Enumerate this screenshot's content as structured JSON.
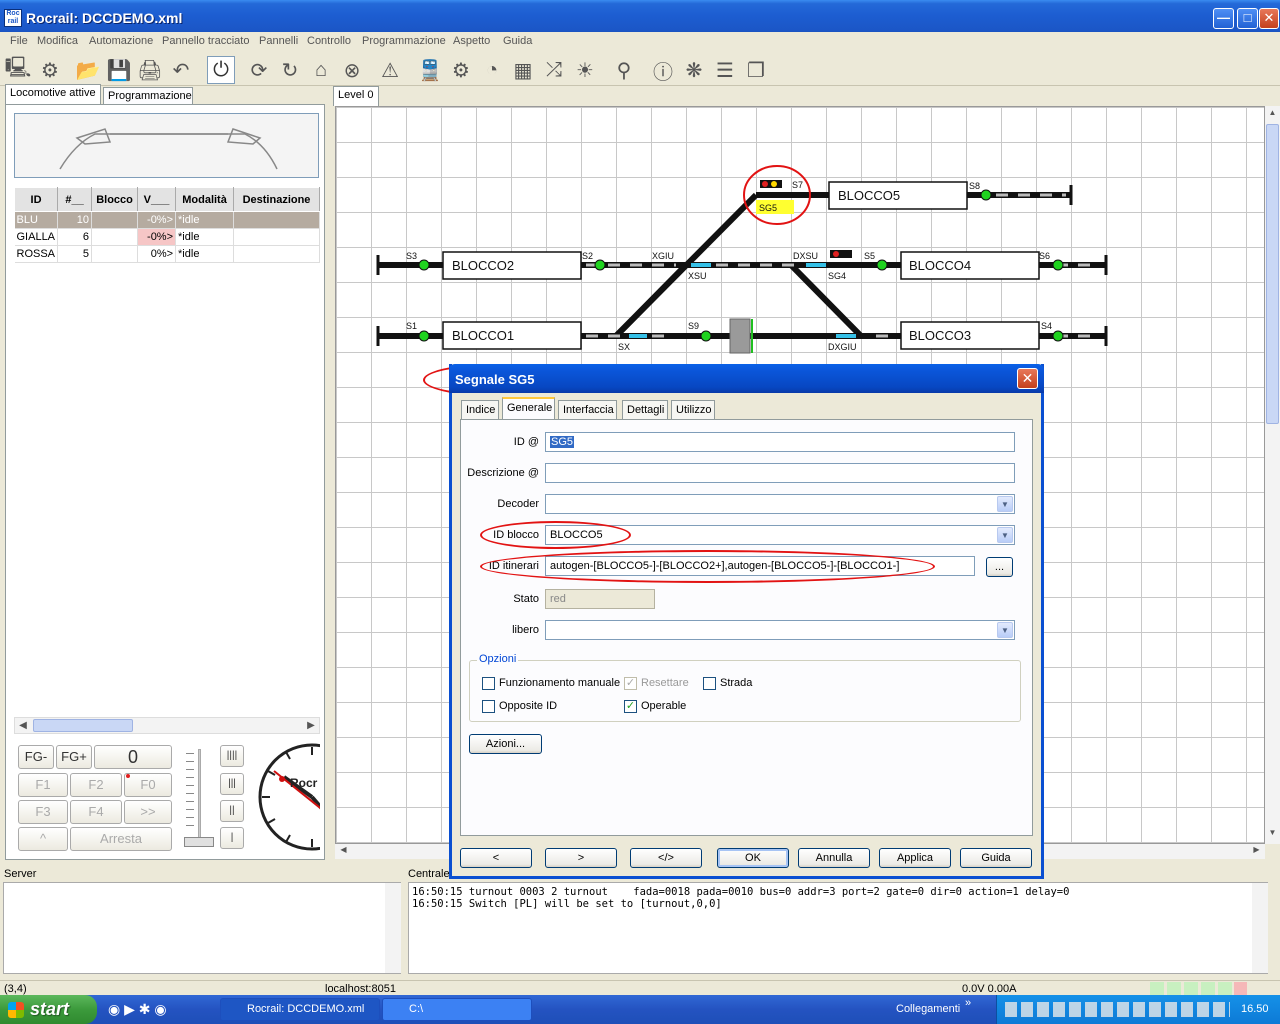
{
  "window": {
    "title": "Rocrail: DCCDEMO.xml",
    "icon_text": "Roc rail"
  },
  "menu": [
    "File",
    "Modifica",
    "Automazione",
    "Pannello tracciato",
    "Pannelli",
    "Controllo",
    "Programmazione",
    "Aspetto",
    "Guida"
  ],
  "left_tabs": [
    "Locomotive attive",
    "Programmazione"
  ],
  "loco_table": {
    "headers": [
      "ID",
      "#__",
      "Blocco",
      "V___",
      "Modalità",
      "Destinazione"
    ],
    "rows": [
      [
        "BLU",
        "10",
        "",
        "-0%>",
        "*idle",
        ""
      ],
      [
        "GIALLA",
        "6",
        "",
        "-0%>",
        "*idle",
        ""
      ],
      [
        "ROSSA",
        "5",
        "",
        "0%>",
        "*idle",
        ""
      ]
    ]
  },
  "controls": {
    "fg_minus": "FG-",
    "fg_plus": "FG+",
    "speed": "0",
    "f1": "F1",
    "f2": "F2",
    "f0": "F0",
    "f3": "F3",
    "f4": "F4",
    "more": ">>",
    "dir": "^",
    "stop": "Arresta",
    "clock_text": "Rocr"
  },
  "plan": {
    "tab": "Level 0",
    "blocks": [
      "BLOCCO5",
      "BLOCCO2",
      "BLOCCO4",
      "BLOCCO1",
      "BLOCCO3"
    ],
    "labels": [
      "S7",
      "S8",
      "SG5",
      "S3",
      "S2",
      "XGIU",
      "DXSU",
      "S5",
      "S6",
      "XSU",
      "SG4",
      "S1",
      "S9",
      "S4",
      "SX",
      "DXGIU"
    ]
  },
  "dialog": {
    "title": "Segnale SG5",
    "tabs": [
      "Indice",
      "Generale",
      "Interfaccia",
      "Dettagli",
      "Utilizzo"
    ],
    "fields": {
      "id_label": "ID @",
      "id_value": "SG5",
      "desc_label": "Descrizione @",
      "desc_value": "",
      "decoder_label": "Decoder",
      "decoder_value": "",
      "block_label": "ID blocco",
      "block_value": "BLOCCO5",
      "routes_label": "ID itinerari",
      "routes_value": "autogen-[BLOCCO5-]-[BLOCCO2+],autogen-[BLOCCO5-]-[BLOCCO1-]",
      "routes_btn": "...",
      "state_label": "Stato",
      "state_value": "red",
      "free_label": "libero",
      "free_value": ""
    },
    "options": {
      "legend": "Opzioni",
      "manual": "Funzionamento manuale",
      "reset": "Resettare",
      "road": "Strada",
      "opposite": "Opposite ID",
      "operable": "Operable"
    },
    "actions_btn": "Azioni...",
    "buttons": [
      "<",
      ">",
      "</>",
      "OK",
      "Annulla",
      "Applica",
      "Guida"
    ]
  },
  "bottom": {
    "server_label": "Server",
    "central_label": "Centrale",
    "log": [
      "16:50:15 turnout 0003 2 turnout    fada=0018 pada=0010 bus=0 addr=3 port=2 gate=0 dir=0 action=1 delay=0",
      "16:50:15 Switch [PL] will be set to [turnout,0,0]"
    ]
  },
  "status": {
    "coords": "(3,4)",
    "host": "localhost:8051",
    "power": "0.0V 0.00A"
  },
  "taskbar": {
    "start": "start",
    "tasks": [
      "Rocrail: DCCDEMO.xml",
      "C:\\"
    ],
    "links": "Collegamenti",
    "clock": "16.50"
  }
}
